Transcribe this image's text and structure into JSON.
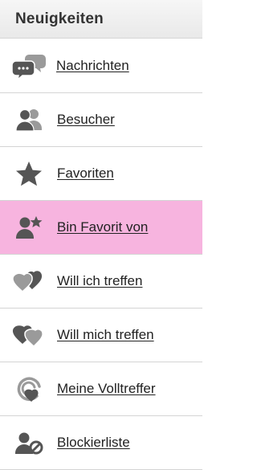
{
  "panel": {
    "title": "Neuigkeiten",
    "items": [
      {
        "label": "Nachrichten",
        "icon": "chat-bubbles-icon",
        "active": false
      },
      {
        "label": "Besucher",
        "icon": "users-icon",
        "active": false
      },
      {
        "label": "Favoriten",
        "icon": "star-icon",
        "active": false
      },
      {
        "label": "Bin Favorit von",
        "icon": "user-star-icon",
        "active": true
      },
      {
        "label": "Will ich treffen",
        "icon": "hearts-icon",
        "active": false
      },
      {
        "label": "Will mich treffen",
        "icon": "hearts-icon",
        "active": false
      },
      {
        "label": "Meine Volltreffer",
        "icon": "target-heart-icon",
        "active": false
      },
      {
        "label": "Blockierliste",
        "icon": "user-blocked-icon",
        "active": false
      }
    ]
  },
  "colors": {
    "header_bg": "#ececec",
    "active_bg": "#f7b4df",
    "icon_gray": "#555555",
    "icon_light_gray": "#9a9a9a",
    "text": "#222222"
  }
}
